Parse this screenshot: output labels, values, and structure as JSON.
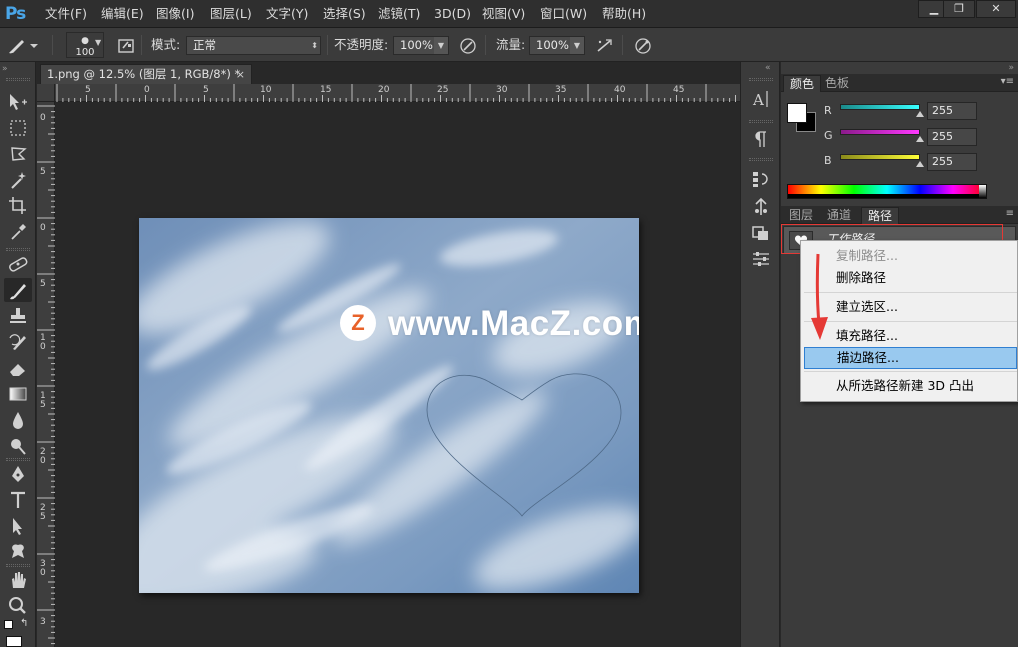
{
  "app": {
    "logo": "Ps",
    "menu": [
      "文件(F)",
      "编辑(E)",
      "图像(I)",
      "图层(L)",
      "文字(Y)",
      "选择(S)",
      "滤镜(T)",
      "3D(D)",
      "视图(V)",
      "窗口(W)",
      "帮助(H)"
    ],
    "window_controls": [
      "minimize-icon",
      "restore-icon",
      "close-icon"
    ]
  },
  "options": {
    "brush_size": "100",
    "mode_label": "模式:",
    "mode_value": "正常",
    "opacity_label": "不透明度:",
    "opacity_value": "100%",
    "flow_label": "流量:",
    "flow_value": "100%"
  },
  "document": {
    "tab_title": "1.png @ 12.5% (图层 1, RGB/8*) *",
    "close_glyph": "×",
    "ruler_h": [
      "5",
      "0",
      "5",
      "10",
      "15",
      "20",
      "25",
      "30",
      "35",
      "40",
      "45"
    ],
    "ruler_v": [
      "0",
      "5",
      "0",
      "5",
      "1 0",
      "1 5",
      "2 0",
      "2 5",
      "3 0",
      "3"
    ],
    "watermark_logo": "Z",
    "watermark_text": "www.MacZ.com"
  },
  "panels": {
    "color_tabs": [
      "颜色",
      "色板"
    ],
    "active_color_tab": 0,
    "channels": [
      {
        "label": "R",
        "value": "255",
        "gradient_start": "#1a8a8a",
        "gradient_end": "#38ffff"
      },
      {
        "label": "G",
        "value": "255",
        "gradient_start": "#8a1a8a",
        "gradient_end": "#ff38ff"
      },
      {
        "label": "B",
        "value": "255",
        "gradient_start": "#8a8a1a",
        "gradient_end": "#ffff38"
      }
    ],
    "layer_tabs": [
      "图层",
      "通道",
      "路径"
    ],
    "active_layer_tab": 2,
    "path_name": "工作路径"
  },
  "context_menu": {
    "items": [
      {
        "label": "复制路径...",
        "state": "disabled"
      },
      {
        "label": "删除路径",
        "state": "normal"
      },
      {
        "label": "建立选区...",
        "state": "normal"
      },
      {
        "label": "填充路径...",
        "state": "normal"
      },
      {
        "label": "描边路径...",
        "state": "hover"
      },
      {
        "label": "从所选路径新建 3D 凸出",
        "state": "normal"
      }
    ]
  },
  "colors": {
    "accent_red": "#e53935",
    "menu_hover": "#99c9ef",
    "ps_blue": "#4aa6e8"
  },
  "tools": [
    "move-tool-icon",
    "marquee-tool-icon",
    "lasso-tool-icon",
    "magic-wand-icon",
    "crop-tool-icon",
    "eyedropper-icon",
    "healing-brush-icon",
    "brush-tool-icon",
    "clone-stamp-icon",
    "history-brush-icon",
    "eraser-icon",
    "gradient-tool-icon",
    "blur-tool-icon",
    "dodge-tool-icon",
    "pen-tool-icon",
    "type-tool-icon",
    "path-selection-icon",
    "custom-shape-icon",
    "hand-tool-icon",
    "zoom-tool-icon"
  ]
}
